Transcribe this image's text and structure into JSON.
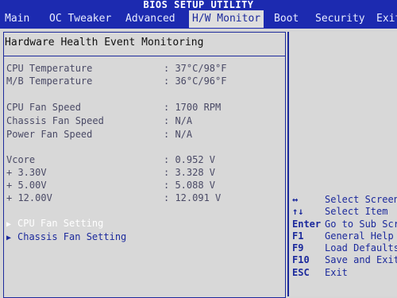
{
  "app_title": "BIOS SETUP UTILITY",
  "tabs": [
    {
      "label": "Main"
    },
    {
      "label": "OC Tweaker"
    },
    {
      "label": "Advanced"
    },
    {
      "label": "H/W Monitor"
    },
    {
      "label": "Boot"
    },
    {
      "label": "Security"
    },
    {
      "label": "Exit"
    }
  ],
  "active_tab": "H/W Monitor",
  "section_title": "Hardware Health Event Monitoring",
  "readings": [
    {
      "label": "CPU Temperature",
      "value": ": 37°C/98°F"
    },
    {
      "label": "M/B Temperature",
      "value": ": 36°C/96°F"
    },
    {
      "label": "CPU Fan Speed",
      "value": ": 1700 RPM"
    },
    {
      "label": "Chassis Fan Speed",
      "value": ": N/A"
    },
    {
      "label": "Power Fan Speed",
      "value": ": N/A"
    },
    {
      "label": "Vcore",
      "value": ": 0.952 V"
    },
    {
      "label": "+ 3.30V",
      "value": ": 3.328 V"
    },
    {
      "label": "+ 5.00V",
      "value": ": 5.088 V"
    },
    {
      "label": "+ 12.00V",
      "value": ": 12.091 V"
    }
  ],
  "menu_items": [
    {
      "label": "CPU Fan Setting",
      "arrow": "▶",
      "highlighted": true
    },
    {
      "label": "Chassis Fan Setting",
      "arrow": "▶",
      "highlighted": false
    }
  ],
  "help": [
    {
      "key": "↔",
      "desc": "Select Screen"
    },
    {
      "key": "↑↓",
      "desc": "Select Item"
    },
    {
      "key": "Enter",
      "desc": "Go to Sub Screen"
    },
    {
      "key": "F1",
      "desc": "General Help"
    },
    {
      "key": "F9",
      "desc": "Load Defaults"
    },
    {
      "key": "F10",
      "desc": "Save and Exit"
    },
    {
      "key": "ESC",
      "desc": "Exit"
    }
  ],
  "colors": {
    "background": "#1c1d9c",
    "panel": "#d8d8d8",
    "accent": "#1c2a9c",
    "value_text": "#4a4a66",
    "highlight_text": "#ffffff"
  }
}
